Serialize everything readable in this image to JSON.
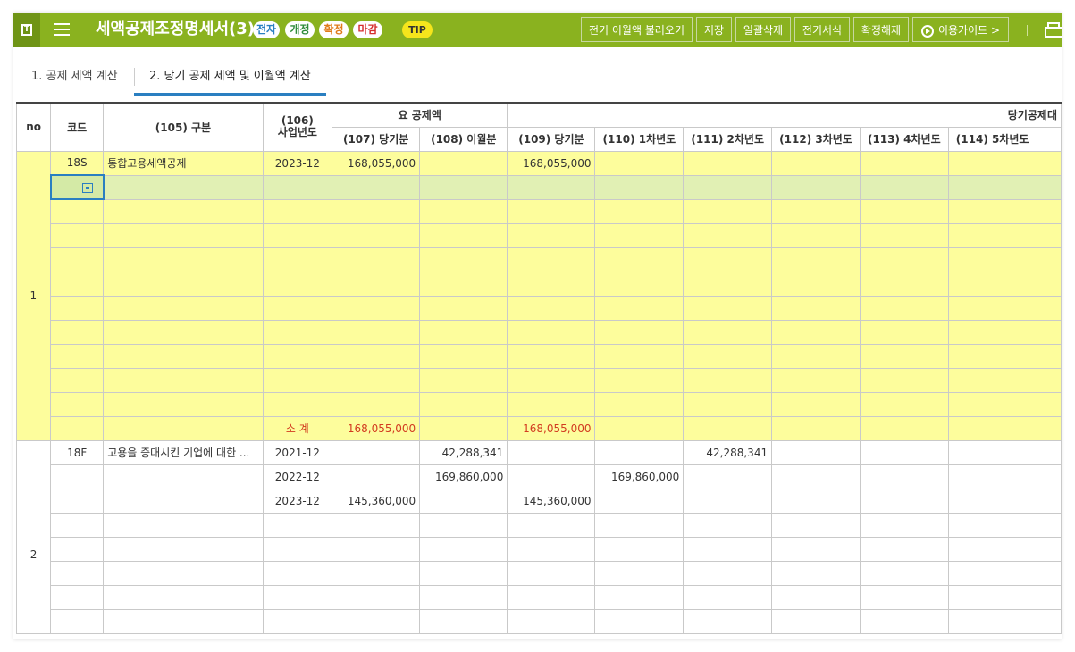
{
  "app": {
    "title": "세액공제조정명세서(3)",
    "badges": [
      "전자",
      "개정",
      "확정",
      "마감"
    ],
    "tip": "TIP"
  },
  "toolbar": {
    "load_prev": "전기 이월액 불러오기",
    "save": "저장",
    "bulk_delete": "일괄삭제",
    "prev_format": "전기서식",
    "unconfirm": "확정해제",
    "guide": "이용가이드 >"
  },
  "tabs": [
    "1. 공제 세액 계산",
    "2. 당기 공제 세액 및 이월액 계산"
  ],
  "table": {
    "headers": {
      "no": "no",
      "code": "코드",
      "cat": "(105) 구분",
      "year_top": "(106)",
      "year_bottom": "사업년도",
      "req_group": "요 공제액",
      "cur_group": "당기공제대",
      "c107": "(107) 당기분",
      "c108": "(108) 이월분",
      "c109": "(109) 당기분",
      "c110": "(110) 1차년도",
      "c111": "(111) 2차년도",
      "c112": "(112) 3차년도",
      "c113": "(113) 4차년도",
      "c114": "(114) 5차년도"
    },
    "group1": {
      "no": "1",
      "code": "18S",
      "name": "통합고용세액공제",
      "year": "2023-12",
      "c107": "168,055,000",
      "c109": "168,055,000",
      "subtotal_label": "소  계",
      "subtotal_107": "168,055,000",
      "subtotal_109": "168,055,000"
    },
    "group2": {
      "no": "2",
      "code": "18F",
      "name": "고용을 증대시킨 기업에 대한 ...",
      "rows": [
        {
          "year": "2021-12",
          "c107": "",
          "c108": "42,288,341",
          "c109": "",
          "c110": "",
          "c111": "42,288,341"
        },
        {
          "year": "2022-12",
          "c107": "",
          "c108": "169,860,000",
          "c109": "",
          "c110": "169,860,000",
          "c111": ""
        },
        {
          "year": "2023-12",
          "c107": "145,360,000",
          "c108": "",
          "c109": "145,360,000",
          "c110": "",
          "c111": ""
        }
      ]
    }
  }
}
